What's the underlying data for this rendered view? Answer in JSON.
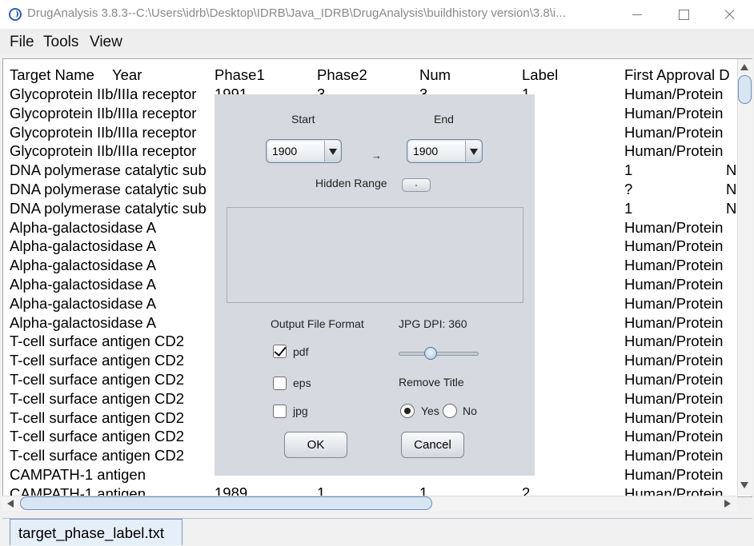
{
  "window": {
    "title": "DrugAnalysis 3.8.3--C:\\Users\\idrb\\Desktop\\IDRB\\Java_IDRB\\DrugAnalysis\\buildhistory version\\3.8\\i..."
  },
  "menubar": {
    "items": [
      "File",
      "Tools",
      "View"
    ]
  },
  "table": {
    "headers": [
      "Target Name",
      "Year",
      "Phase1",
      "Phase2",
      "Num",
      "Label",
      "First Approval D"
    ],
    "col1_rows": [
      "Glycoprotein IIb/IIIa receptor",
      "Glycoprotein IIb/IIIa receptor",
      "Glycoprotein IIb/IIIa receptor",
      "Glycoprotein IIb/IIIa receptor",
      "DNA polymerase catalytic sub",
      "DNA polymerase catalytic sub",
      "DNA polymerase catalytic sub",
      "Alpha-galactosidase A",
      "Alpha-galactosidase A",
      "Alpha-galactosidase A",
      "Alpha-galactosidase A",
      "Alpha-galactosidase A",
      "Alpha-galactosidase A",
      "T-cell surface antigen CD2",
      "T-cell surface antigen CD2",
      "T-cell surface antigen CD2",
      "T-cell surface antigen CD2",
      "T-cell surface antigen CD2",
      "T-cell surface antigen CD2",
      "T-cell surface antigen CD2",
      "CAMPATH-1 antigen",
      "CAMPATH-1 antigen"
    ],
    "first_row_partial": {
      "year": "1991",
      "phase2": "3",
      "num": "3",
      "label": "1"
    },
    "visible_cells_bottom_row": {
      "year": "1989",
      "phase2": "1",
      "num": "1",
      "label": "2"
    },
    "first_approval_col": [
      "Human/Protein",
      "Human/Protein",
      "Human/Protein",
      "Human/Protein",
      "1",
      "?",
      "1",
      "Human/Protein",
      "Human/Protein",
      "Human/Protein",
      "Human/Protein",
      "Human/Protein",
      "Human/Protein",
      "Human/Protein",
      "Human/Protein",
      "Human/Protein",
      "Human/Protein",
      "Human/Protein",
      "Human/Protein",
      "Human/Protein",
      "Human/Protein",
      "Human/Protein"
    ],
    "edge_col_partial": [
      "N",
      "N",
      "N"
    ]
  },
  "dialog": {
    "start_label": "Start",
    "end_label": "End",
    "start_value": "1900",
    "end_value": "1900",
    "arrow": "→",
    "hidden_range_label": "Hidden Range",
    "output_format_label": "Output File Format",
    "jpg_dpi_label": "JPG DPI: 360",
    "jpg_dpi_value": 360,
    "formats": [
      {
        "label": "pdf",
        "checked": true
      },
      {
        "label": "eps",
        "checked": false
      },
      {
        "label": "jpg",
        "checked": false
      }
    ],
    "remove_title_label": "Remove Title",
    "yes_label": "Yes",
    "no_label": "No",
    "remove_title_selected": "Yes",
    "ok_label": "OK",
    "cancel_label": "Cancel"
  },
  "file_tab": {
    "label": "target_phase_label.txt"
  }
}
